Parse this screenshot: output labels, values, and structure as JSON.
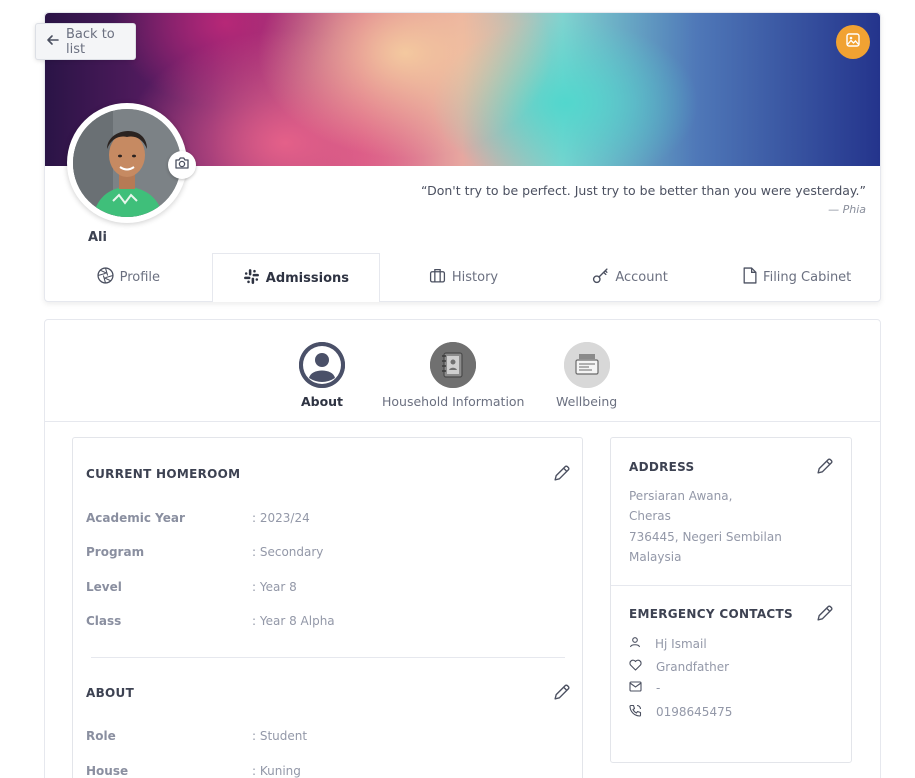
{
  "back_button": {
    "label": "Back to list",
    "icon": "arrow-left-icon"
  },
  "cover": {
    "change_icon": "image-icon",
    "accent": "#f1a232"
  },
  "profile": {
    "name": "Ali",
    "camera_icon": "camera-icon",
    "quote": "“Don't try to be perfect. Just try to be better than you were yesterday.”",
    "quote_author": "— Phia"
  },
  "tabs": [
    {
      "label": "Profile",
      "icon": "aperture-icon",
      "active": false
    },
    {
      "label": "Admissions",
      "icon": "slack-icon",
      "active": true
    },
    {
      "label": "History",
      "icon": "briefcase-icon",
      "active": false
    },
    {
      "label": "Account",
      "icon": "key-icon",
      "active": false
    },
    {
      "label": "Filing Cabinet",
      "icon": "file-icon",
      "active": false
    }
  ],
  "subtabs": [
    {
      "label": "About",
      "icon": "user-circle-icon",
      "active": true
    },
    {
      "label": "Household Information",
      "icon": "address-book-icon",
      "active": false
    },
    {
      "label": "Wellbeing",
      "icon": "wellbeing-icon",
      "active": false
    }
  ],
  "homeroom": {
    "title": "CURRENT HOMEROOM",
    "rows": [
      {
        "key": "Academic Year",
        "value": ": 2023/24"
      },
      {
        "key": "Program",
        "value": ": Secondary"
      },
      {
        "key": "Level",
        "value": ": Year 8"
      },
      {
        "key": "Class",
        "value": ": Year 8 Alpha"
      }
    ]
  },
  "about": {
    "title": "ABOUT",
    "rows": [
      {
        "key": "Role",
        "value": ": Student"
      },
      {
        "key": "House",
        "value": ": Kuning"
      }
    ]
  },
  "address": {
    "title": "ADDRESS",
    "lines": [
      "Persiaran Awana,",
      "Cheras",
      "736445, Negeri Sembilan",
      "Malaysia"
    ]
  },
  "emergency": {
    "title": "EMERGENCY CONTACTS",
    "name": "Hj Ismail",
    "relation": "Grandfather",
    "email": "-",
    "phone": "0198645475"
  }
}
